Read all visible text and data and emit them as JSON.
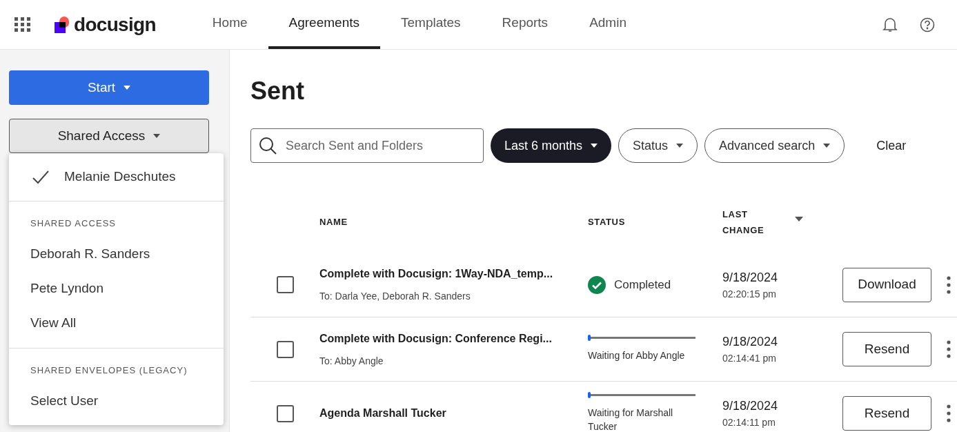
{
  "nav": {
    "logo": "docusign",
    "tabs": [
      {
        "label": "Home",
        "selected": false
      },
      {
        "label": "Agreements",
        "selected": true
      },
      {
        "label": "Templates",
        "selected": false
      },
      {
        "label": "Reports",
        "selected": false
      },
      {
        "label": "Admin",
        "selected": false
      }
    ]
  },
  "sidebar": {
    "start_button": "Start",
    "shared_access_button": "Shared Access"
  },
  "dropdown": {
    "current": {
      "label": "Melanie Deschutes",
      "checked": true
    },
    "sections": [
      {
        "heading": "SHARED ACCESS",
        "items": [
          "Deborah R. Sanders",
          "Pete Lyndon",
          "View All"
        ]
      },
      {
        "heading": "SHARED ENVELOPES (LEGACY)",
        "items": [
          "Select User"
        ]
      }
    ]
  },
  "page_title": "Sent",
  "filters": {
    "search_placeholder": "Search Sent and Folders",
    "chips": [
      {
        "label": "Last 6 months",
        "selected": true
      },
      {
        "label": "Status",
        "selected": false
      },
      {
        "label": "Advanced search",
        "selected": false
      }
    ],
    "clear": "Clear"
  },
  "table": {
    "columns": [
      "NAME",
      "STATUS",
      "LAST\nCHANGE"
    ],
    "rows": [
      {
        "checked": false,
        "name": "Complete with Docusign: 1Way-NDA_temp...",
        "to": "To: Darla Yee, Deborah R. Sanders",
        "kind": "completed",
        "status": "Completed",
        "date": "9/18/2024",
        "time": "02:20:15 pm",
        "action": "Download"
      },
      {
        "checked": false,
        "name": "Complete with Docusign: Conference Regi...",
        "to": "To: Abby Angle",
        "kind": "waiting",
        "level": 0.02,
        "status": "Waiting for Abby Angle",
        "date": "9/18/2024",
        "time": "02:14:41 pm",
        "action": "Resend"
      },
      {
        "checked": false,
        "name": "Agenda Marshall Tucker",
        "kind": "waiting",
        "level": 0.02,
        "status": "Waiting for Marshall Tucker",
        "date": "9/18/2024",
        "time": "02:14:11 pm",
        "action": "Resend"
      }
    ]
  }
}
